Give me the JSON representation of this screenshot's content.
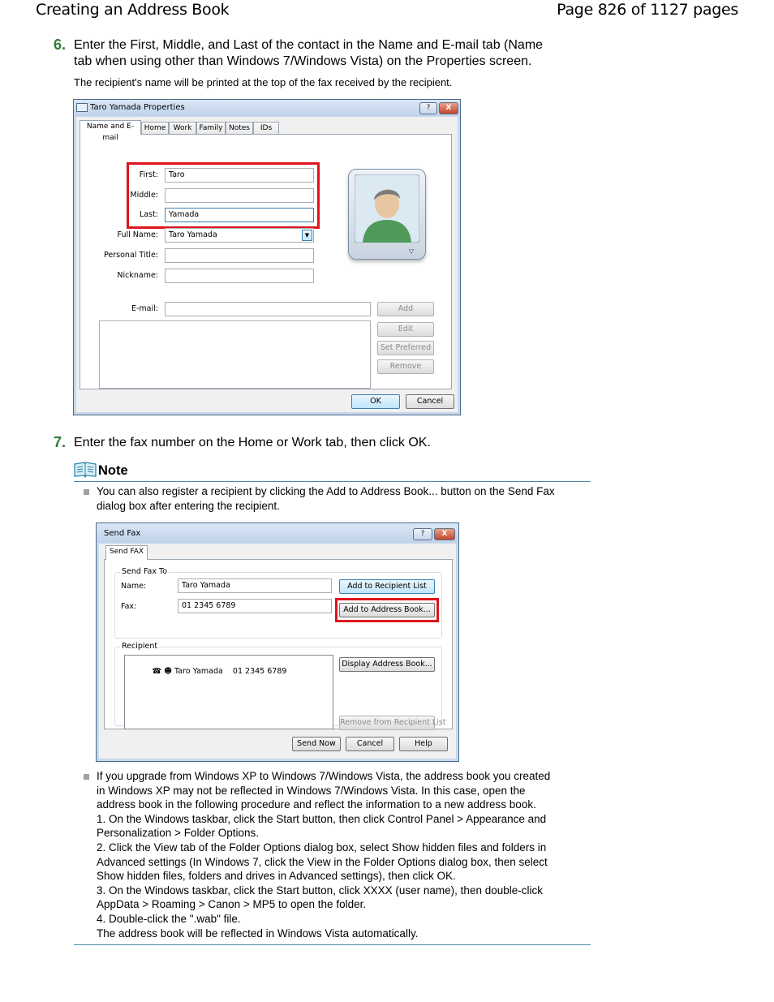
{
  "header": {
    "title": "Creating an Address Book",
    "page": "Page 826 of 1127 pages"
  },
  "step6": {
    "number": "6.",
    "lines": [
      "Enter the First, Middle, and Last of the contact in the Name and E-mail tab (Name",
      "tab when using other than Windows 7/Windows Vista) on the Properties screen."
    ],
    "subtext": "The recipient's name will be printed at the top of the fax received by the recipient."
  },
  "properties_dialog": {
    "title": "Taro Yamada Properties",
    "help_btn": "?",
    "close_btn": "X",
    "tabs": [
      "Name and E-mail",
      "Home",
      "Work",
      "Family",
      "Notes",
      "IDs"
    ],
    "labels": {
      "first": "First:",
      "middle": "Middle:",
      "last": "Last:",
      "full_name": "Full Name:",
      "personal_title": "Personal Title:",
      "nickname": "Nickname:",
      "email": "E-mail:"
    },
    "values": {
      "first": "Taro",
      "middle": "",
      "last": "Yamada",
      "full_name": "Taro Yamada",
      "personal_title": "",
      "nickname": "",
      "email": ""
    },
    "buttons": {
      "add": "Add",
      "edit": "Edit",
      "set_preferred": "Set Preferred",
      "remove": "Remove",
      "ok": "OK",
      "cancel": "Cancel"
    }
  },
  "step7": {
    "number": "7.",
    "text": "Enter the fax number on the Home or Work tab, then click OK."
  },
  "note": {
    "label": "Note",
    "item1_lines": [
      "You can also register a recipient by clicking the Add to Address Book... button on the Send Fax",
      "dialog box after entering the recipient."
    ],
    "item2_lines": [
      "If you upgrade from Windows XP to Windows 7/Windows Vista, the address book you created",
      "in Windows XP may not be reflected in Windows 7/Windows Vista. In this case, open the",
      "address book in the following procedure and reflect the information to a new address book.",
      "1. On the Windows taskbar, click the Start button, then click Control Panel > Appearance and",
      "Personalization > Folder Options.",
      "2. Click the View tab of the Folder Options dialog box, select Show hidden files and folders in",
      "Advanced settings (In Windows 7, click the View in the Folder Options dialog box, then select",
      "Show hidden files, folders and drives in Advanced settings), then click OK.",
      "3. On the Windows taskbar, click the Start button, click XXXX (user name), then double-click",
      "AppData > Roaming > Canon > MP5 to open the folder.",
      "4. Double-click the \".wab\" file.",
      "The address book will be reflected in Windows Vista automatically."
    ]
  },
  "sendfax_dialog": {
    "title": "Send Fax",
    "help_btn": "?",
    "close_btn": "X",
    "tab": "Send FAX",
    "group_send_to": "Send Fax To",
    "name_label": "Name:",
    "name_value": "Taro Yamada",
    "fax_label": "Fax:",
    "fax_value": "01 2345 6789",
    "add_recipient_btn": "Add to Recipient List",
    "add_address_btn": "Add to Address Book...",
    "group_recipient": "Recipient",
    "recipient_entry": "Taro Yamada    01 2345 6789",
    "display_address_btn": "Display Address Book...",
    "remove_recipient_btn": "Remove from Recipient List",
    "send_now_btn": "Send Now",
    "cancel_btn": "Cancel",
    "help_label": "Help"
  }
}
